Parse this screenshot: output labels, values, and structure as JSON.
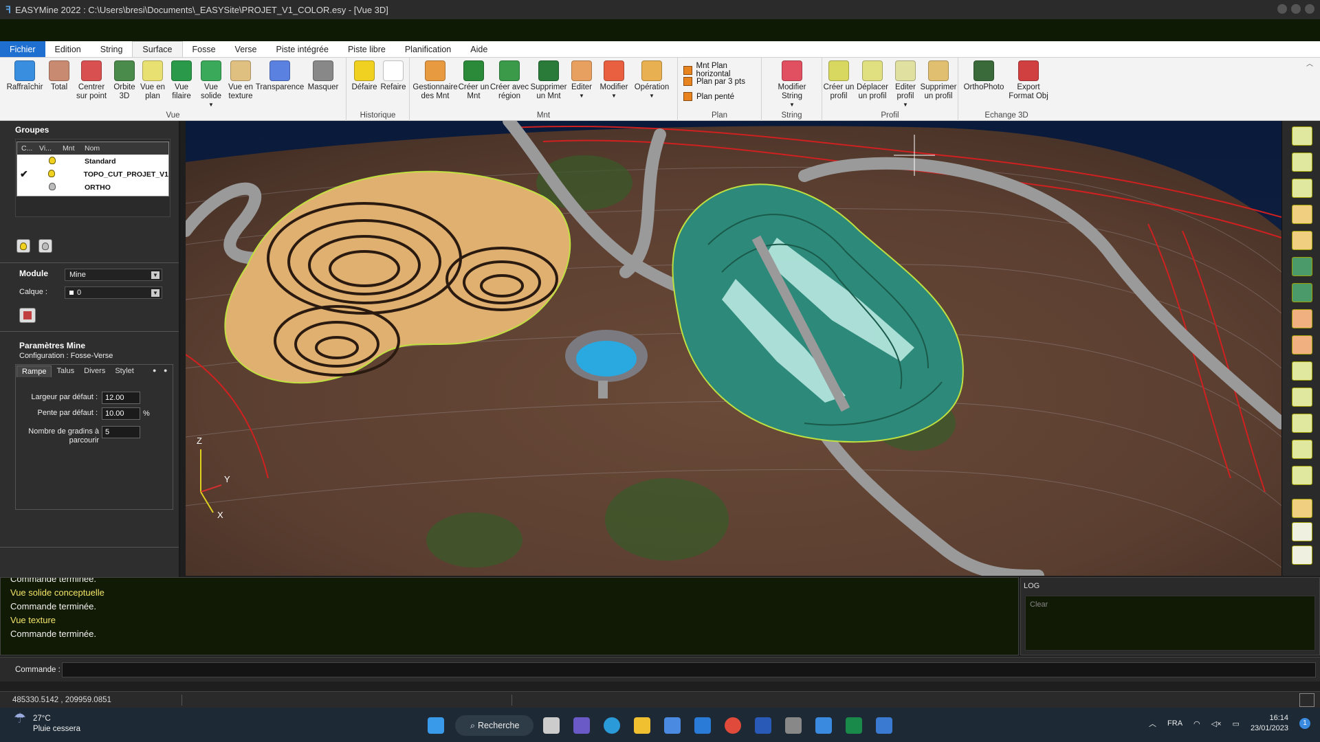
{
  "titlebar": {
    "title": "EASYMine 2022 : C:\\Users\\bresi\\Documents\\_EASYSite\\PROJET_V1_COLOR.esy - [Vue 3D]"
  },
  "menu": [
    "Fichier",
    "Edition",
    "String",
    "Surface",
    "Fosse",
    "Verse",
    "Piste intégrée",
    "Piste libre",
    "Planification",
    "Aide"
  ],
  "ribbon": {
    "vue": {
      "label": "Vue",
      "buttons": [
        "Raffraîchir",
        "Total",
        "Centrer sur point",
        "Orbite 3D",
        "Vue en plan",
        "Vue filaire",
        "Vue solide",
        "Vue en texture",
        "Transparence",
        "Masquer"
      ]
    },
    "historique": {
      "label": "Historique",
      "buttons": [
        "Défaire",
        "Refaire"
      ]
    },
    "mnt": {
      "label": "Mnt",
      "buttons": [
        "Gestionnaire des Mnt",
        "Créer un Mnt",
        "Créer avec région",
        "Supprimer un Mnt",
        "Editer",
        "Modifier",
        "Opération"
      ]
    },
    "plan": {
      "label": "Plan",
      "items": [
        "Mnt Plan horizontal",
        "Plan par 3 pts",
        "Plan penté"
      ]
    },
    "string": {
      "label": "String",
      "buttons": [
        "Modifier String"
      ]
    },
    "profil": {
      "label": "Profil",
      "buttons": [
        "Créer un profil",
        "Déplacer un profil",
        "Editer profil",
        "Supprimer un profil"
      ]
    },
    "echange": {
      "label": "Echange 3D",
      "buttons": [
        "OrthoPhoto",
        "Export Format Obj"
      ]
    }
  },
  "groups": {
    "title": "Groupes",
    "headers": [
      "C...",
      "Vi...",
      "Mnt",
      "Nom"
    ],
    "rows": [
      {
        "name": "Standard",
        "checked": false,
        "bulb": "yellow"
      },
      {
        "name": "TOPO_CUT_PROJET_V1",
        "checked": true,
        "bulb": "yellow"
      },
      {
        "name": "ORTHO",
        "checked": false,
        "bulb": "grey"
      }
    ]
  },
  "module": {
    "label": "Module",
    "value": "Mine",
    "calque_label": "Calque :",
    "calque_value": "0"
  },
  "params": {
    "title": "Paramètres Mine",
    "config": "Configuration : Fosse-Verse",
    "tabs": [
      "Rampe",
      "Talus",
      "Divers",
      "Stylet"
    ],
    "fields": [
      {
        "label": "Largeur par défaut :",
        "value": "12.00",
        "unit": ""
      },
      {
        "label": "Pente par défaut :",
        "value": "10.00",
        "unit": "%"
      },
      {
        "label": "Nombre de gradins à parcourir",
        "value": "5",
        "unit": ""
      }
    ]
  },
  "console": {
    "lines": [
      {
        "text": "Commande terminée.",
        "color": "white"
      },
      {
        "text": "Vue solide conceptuelle",
        "color": "yellow"
      },
      {
        "text": "Commande terminée.",
        "color": "white"
      },
      {
        "text": "Vue texture",
        "color": "yellow"
      },
      {
        "text": "Commande terminée.",
        "color": "white"
      }
    ]
  },
  "log": {
    "title": "LOG",
    "clear": "Clear"
  },
  "command": {
    "label": "Commande :"
  },
  "status": {
    "coords": "485330.5142 , 209959.0851"
  },
  "axes": {
    "z": "Z",
    "y": "Y",
    "x": "X"
  },
  "taskbar": {
    "temp": "27°C",
    "weather": "Pluie cessera",
    "search": "Recherche",
    "lang": "FRA",
    "time": "16:14",
    "date": "23/01/2023",
    "notif": "1"
  },
  "colors": {
    "accent": "#1e6fd0",
    "console_bg": "#111a05",
    "console_yellow": "#f5e56a",
    "pit_tan": "#e0b070",
    "pit_green": "#2d8a7a",
    "road": "#9a9a9a",
    "water": "#2aa8e0"
  }
}
